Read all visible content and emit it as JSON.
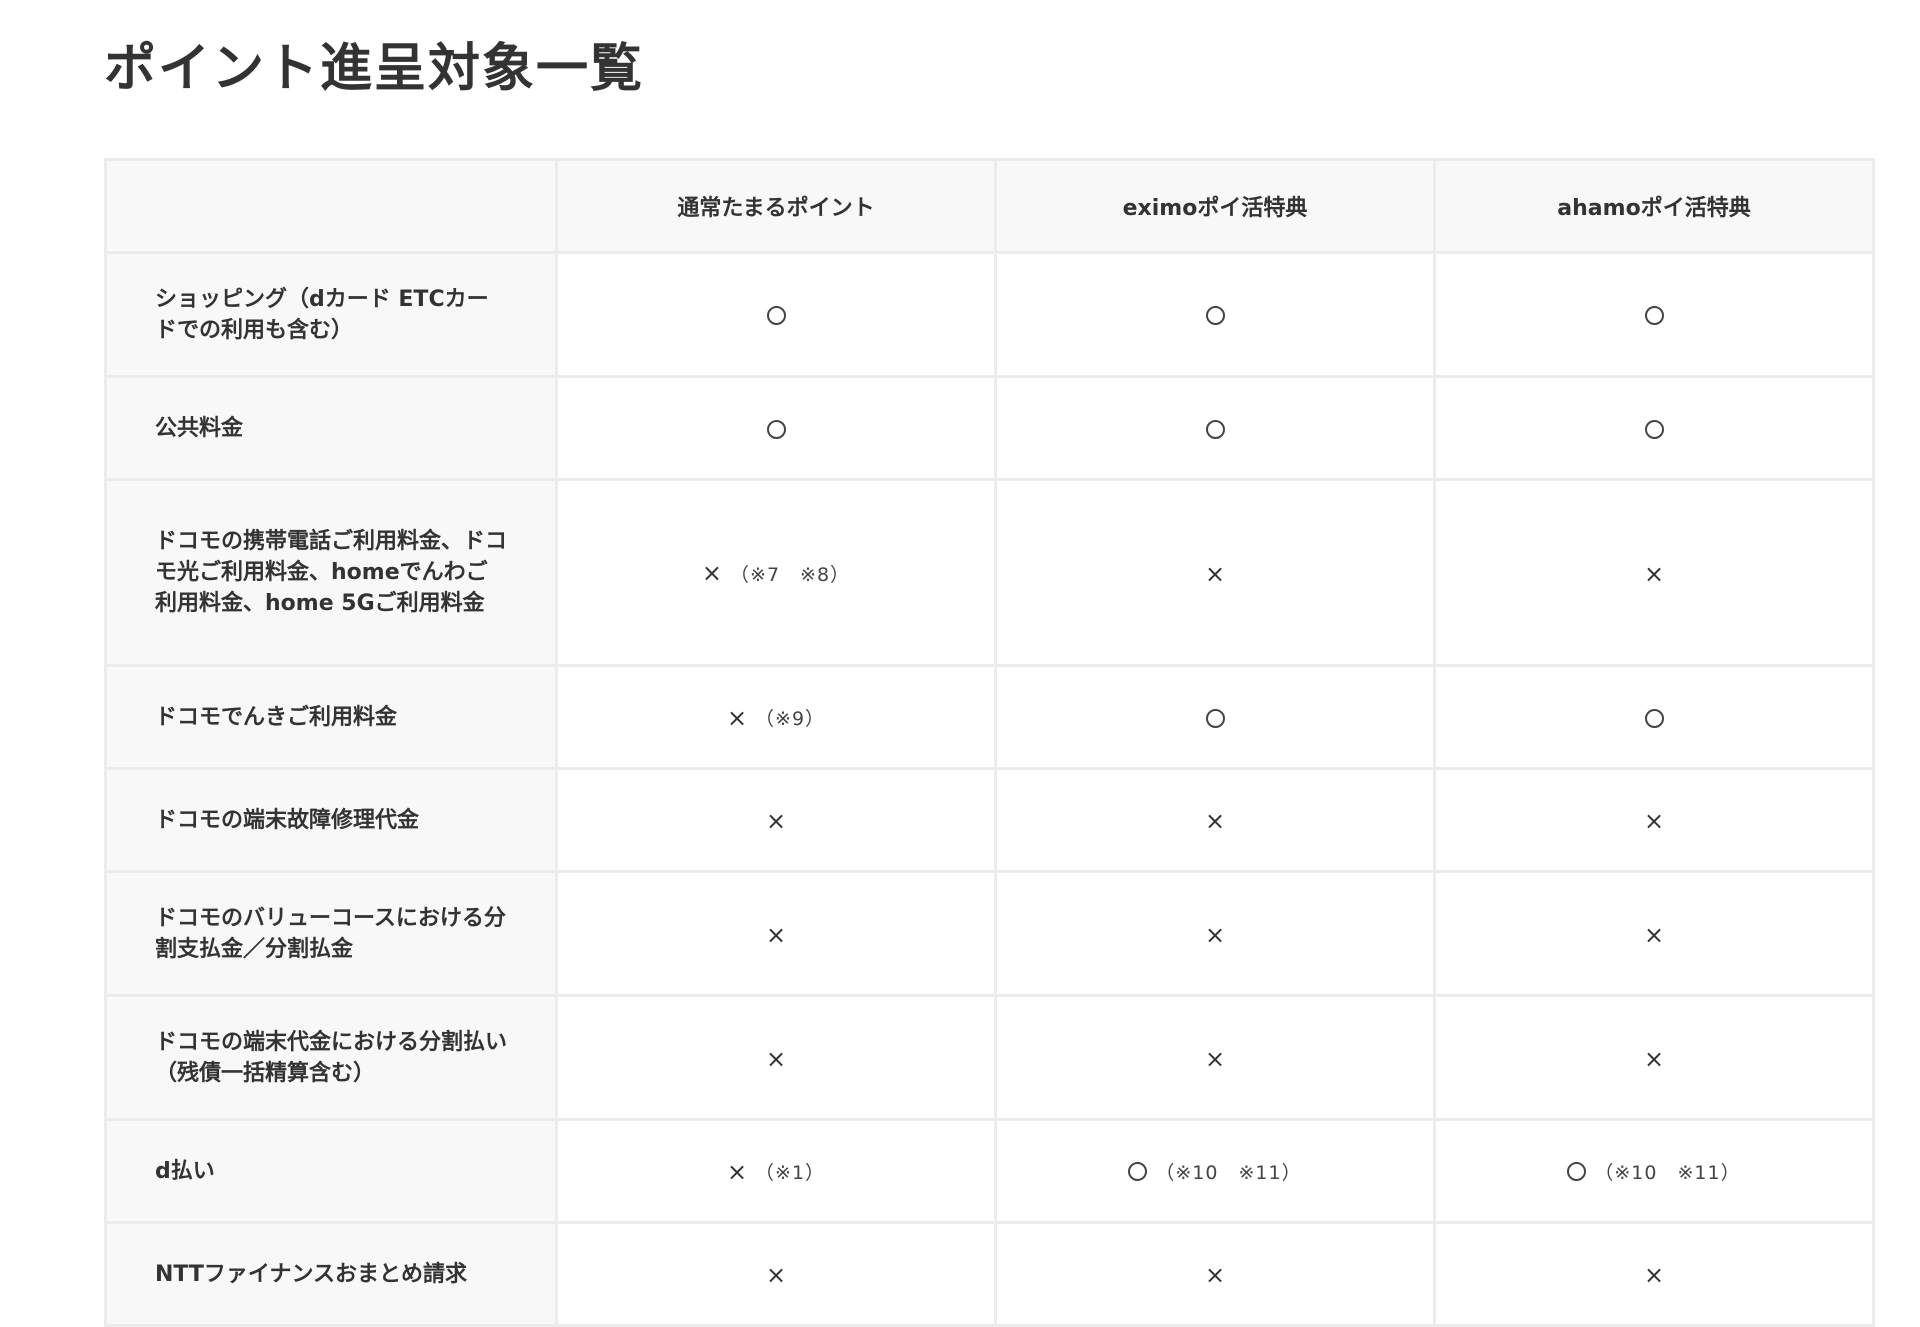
{
  "title": "ポイント進呈対象一覧",
  "table": {
    "columns": [
      "",
      "通常たまるポイント",
      "eximoポイ活特典",
      "ahamoポイ活特典"
    ],
    "rows": [
      {
        "label": "ショッピング（dカード ETCカードでの利用も含む）",
        "height": 124,
        "cells": [
          {
            "mark": "○",
            "note": ""
          },
          {
            "mark": "○",
            "note": ""
          },
          {
            "mark": "○",
            "note": ""
          }
        ]
      },
      {
        "label": "公共料金",
        "height": 103,
        "cells": [
          {
            "mark": "○",
            "note": ""
          },
          {
            "mark": "○",
            "note": ""
          },
          {
            "mark": "○",
            "note": ""
          }
        ]
      },
      {
        "label": "ドコモの携帯電話ご利用料金、ドコモ光ご利用料金、homeでんわご利用料金、home 5Gご利用料金",
        "height": 186,
        "cells": [
          {
            "mark": "×",
            "note": "（※7　※8）"
          },
          {
            "mark": "×",
            "note": ""
          },
          {
            "mark": "×",
            "note": ""
          }
        ]
      },
      {
        "label": "ドコモでんきご利用料金",
        "height": 103,
        "cells": [
          {
            "mark": "×",
            "note": "（※9）"
          },
          {
            "mark": "○",
            "note": ""
          },
          {
            "mark": "○",
            "note": ""
          }
        ]
      },
      {
        "label": "ドコモの端末故障修理代金",
        "height": 103,
        "cells": [
          {
            "mark": "×",
            "note": ""
          },
          {
            "mark": "×",
            "note": ""
          },
          {
            "mark": "×",
            "note": ""
          }
        ]
      },
      {
        "label": "ドコモのバリューコースにおける分割支払金／分割払金",
        "height": 124,
        "cells": [
          {
            "mark": "×",
            "note": ""
          },
          {
            "mark": "×",
            "note": ""
          },
          {
            "mark": "×",
            "note": ""
          }
        ]
      },
      {
        "label": "ドコモの端末代金における分割払い（残債一括精算含む）",
        "height": 124,
        "cells": [
          {
            "mark": "×",
            "note": ""
          },
          {
            "mark": "×",
            "note": ""
          },
          {
            "mark": "×",
            "note": ""
          }
        ]
      },
      {
        "label": "d払い",
        "height": 103,
        "cells": [
          {
            "mark": "×",
            "note": "（※1）"
          },
          {
            "mark": "○",
            "note": "（※10　※11）"
          },
          {
            "mark": "○",
            "note": "（※10　※11）"
          }
        ]
      },
      {
        "label": "NTTファイナンスおまとめ請求",
        "height": 103,
        "cells": [
          {
            "mark": "×",
            "note": ""
          },
          {
            "mark": "×",
            "note": ""
          },
          {
            "mark": "×",
            "note": ""
          }
        ]
      }
    ]
  }
}
